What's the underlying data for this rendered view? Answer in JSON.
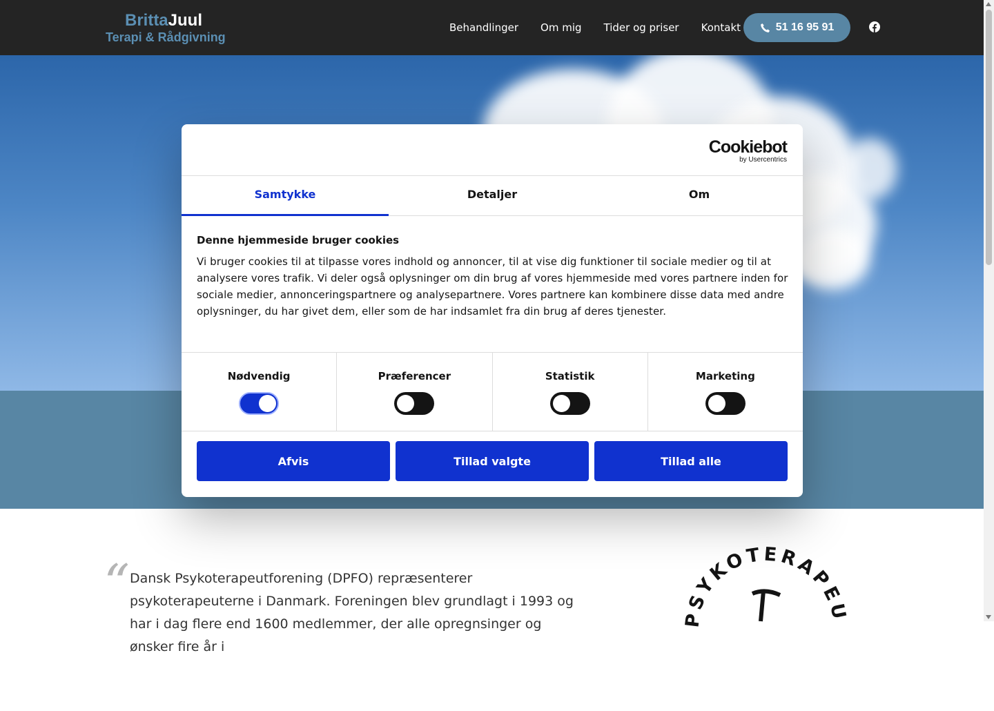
{
  "header": {
    "logo_first": "Britta",
    "logo_last": "Juul",
    "logo_tagline": "Terapi & Rådgivning",
    "nav": [
      "Behandlinger",
      "Om mig",
      "Tider og priser",
      "Kontakt"
    ],
    "phone": "51 16 95 91",
    "phone_icon": "phone-icon",
    "social_icon": "facebook-icon"
  },
  "cookie_dialog": {
    "brand": "Cookiebot",
    "brand_sub": "by Usercentrics",
    "tabs": [
      "Samtykke",
      "Detaljer",
      "Om"
    ],
    "active_tab": "Samtykke",
    "title": "Denne hjemmeside bruger cookies",
    "body": "Vi bruger cookies til at tilpasse vores indhold og annoncer, til at vise dig funktioner til sociale medier og til at analysere vores trafik. Vi deler også oplysninger om din brug af vores hjemmeside med vores partnere inden for sociale medier, annonceringspartnere og analysepartnere. Vores partnere kan kombinere disse data med andre oplysninger, du har givet dem, eller som de har indsamlet fra din brug af deres tjenester.",
    "categories": [
      {
        "label": "Nødvendig",
        "enabled": true
      },
      {
        "label": "Præferencer",
        "enabled": false
      },
      {
        "label": "Statistik",
        "enabled": false
      },
      {
        "label": "Marketing",
        "enabled": false
      }
    ],
    "buttons": {
      "reject": "Afvis",
      "allow_selected": "Tillad valgte",
      "allow_all": "Tillad alle"
    },
    "accent_color": "#1032cf"
  },
  "content": {
    "quote_mark": "“",
    "quote": "Dansk Psykoterapeutforening (DPFO) repræsenterer psykoterapeuterne i Danmark. Foreningen blev grundlagt i 1993 og har i dag flere end 1600 medlemmer, der alle opregnsinger og ønsker fire år i",
    "badge_text": "PSYKOTERAPEUTF"
  },
  "colors": {
    "header_bg": "#242424",
    "brand_blue": "#5886a4",
    "sky_top": "#2c66aa",
    "sky_bottom": "#8fb8e6"
  }
}
